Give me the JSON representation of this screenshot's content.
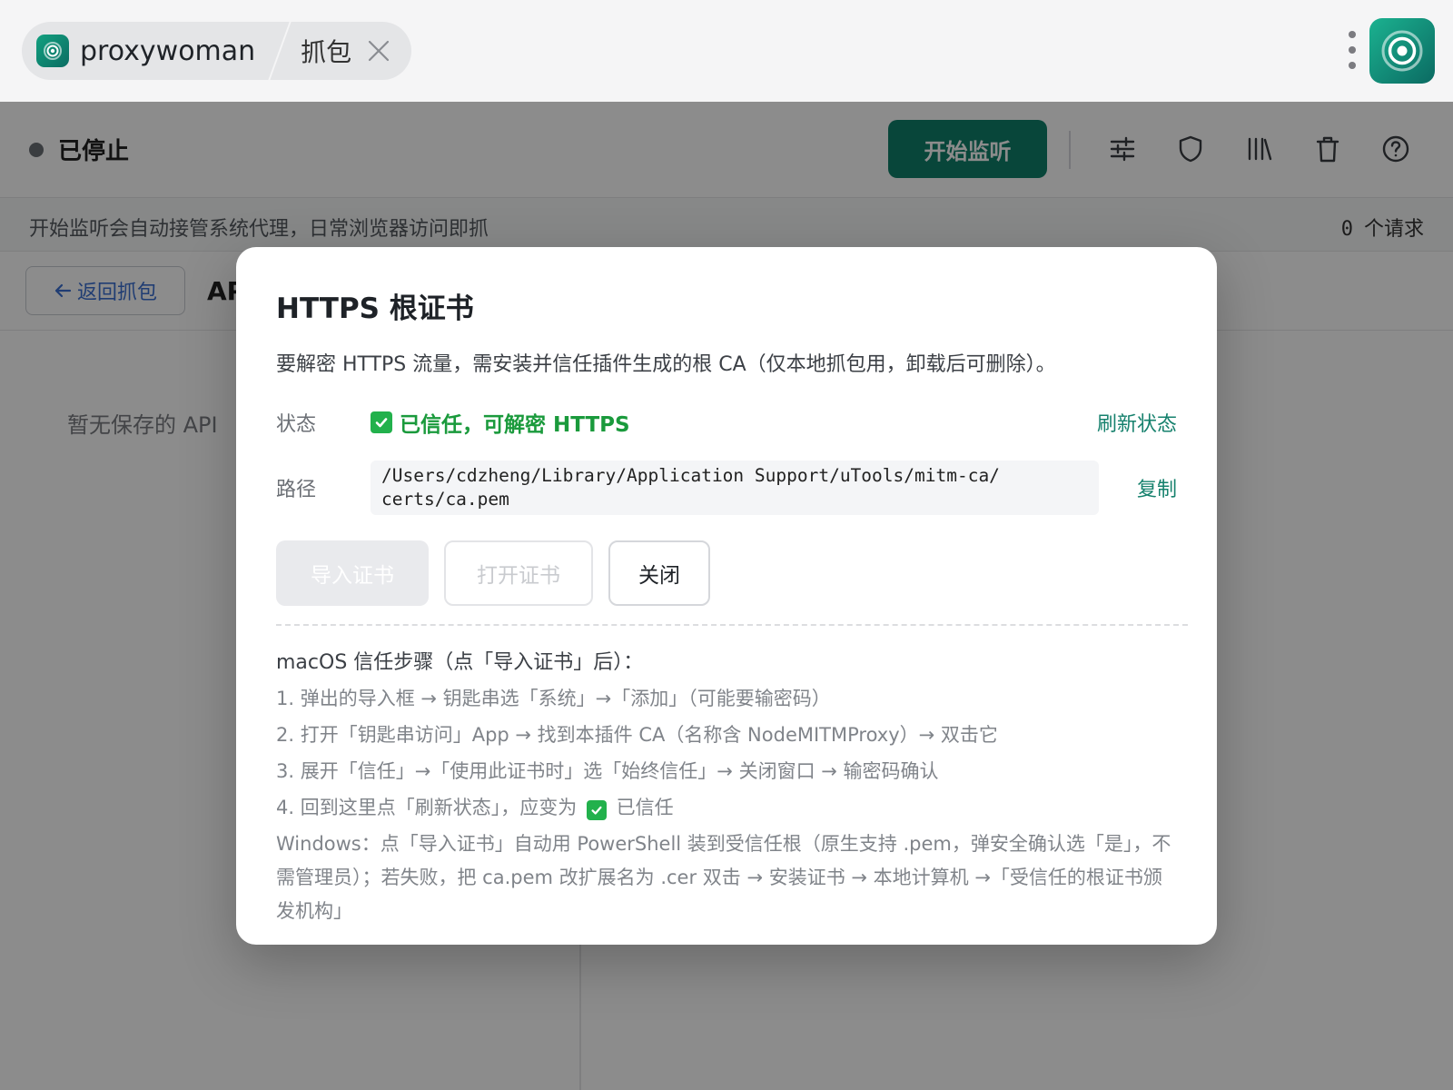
{
  "titlebar": {
    "app_name": "proxywoman",
    "tab_label": "抓包"
  },
  "toolbar": {
    "status": "已停止",
    "start_label": "开始监听"
  },
  "hint": {
    "text": "开始监听会自动接管系统代理，日常浏览器访问即抓",
    "count": "0",
    "count_unit": "个请求"
  },
  "page": {
    "back_label": "返回抓包",
    "title": "AP",
    "empty_text": "暂无保存的 API"
  },
  "modal": {
    "title": "HTTPS 根证书",
    "desc": "要解密 HTTPS 流量，需安装并信任插件生成的根 CA（仅本地抓包用，卸载后可删除）。",
    "status_label": "状态",
    "status_value": "已信任，可解密 HTTPS",
    "refresh_label": "刷新状态",
    "path_label": "路径",
    "path_value": "/Users/cdzheng/Library/Application Support/uTools/mitm-ca/\ncerts/ca.pem",
    "copy_label": "复制",
    "import_label": "导入证书",
    "open_label": "打开证书",
    "close_label": "关闭",
    "steps_title": "macOS 信任步骤（点「导入证书」后）：",
    "step1": "1. 弹出的导入框 → 钥匙串选「系统」→「添加」（可能要输密码）",
    "step2": "2. 打开「钥匙串访问」App → 找到本插件 CA（名称含 NodeMITMProxy）→ 双击它",
    "step3": "3. 展开「信任」→「使用此证书时」选「始终信任」→ 关闭窗口 → 输密码确认",
    "step4_prefix": "4. 回到这里点「刷新状态」，应变为",
    "step4_suffix": "已信任",
    "windows_text": "Windows：点「导入证书」自动用 PowerShell 装到受信任根（原生支持 .pem，弹安全确认选「是」，不需管理员）；若失败，把 ca.pem 改扩展名为 .cer 双击 → 安装证书 → 本地计算机 →「受信任的根证书颁发机构」"
  }
}
